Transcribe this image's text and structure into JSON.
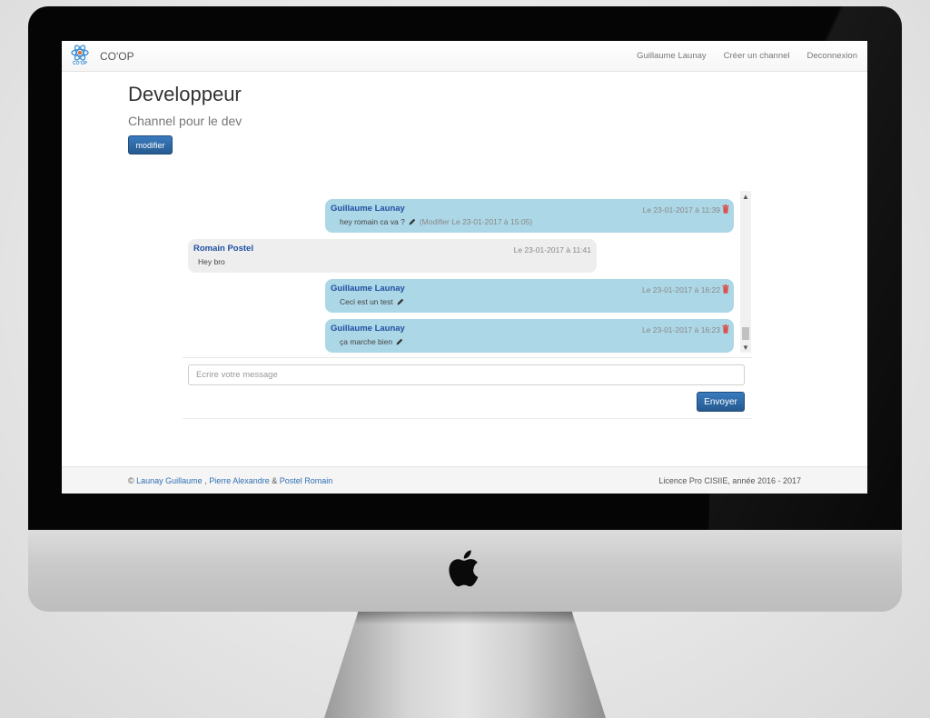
{
  "navbar": {
    "brand": "CO'OP",
    "logo_text": "CO'OP",
    "links": [
      "Guillaume Launay",
      "Créer un channel",
      "Deconnexion"
    ]
  },
  "channel": {
    "title": "Developpeur",
    "description": "Channel pour le dev",
    "modify_label": "modifier"
  },
  "messages": [
    {
      "author": "Guillaume Launay",
      "date": "Le 23-01-2017 à 11:39",
      "text": "hey romain ca va ?",
      "edit_note": "(Modifier Le 23-01-2017 à 15:05)",
      "mine": true
    },
    {
      "author": "Romain Postel",
      "date": "Le 23-01-2017 à 11:41",
      "text": "Hey bro",
      "mine": false
    },
    {
      "author": "Guillaume Launay",
      "date": "Le 23-01-2017 à 16:22",
      "text": "Ceci est un test",
      "mine": true
    },
    {
      "author": "Guillaume Launay",
      "date": "Le 23-01-2017 à 16:23",
      "text": "ça marche bien",
      "mine": true
    }
  ],
  "composer": {
    "placeholder": "Ecrire votre message",
    "send_label": "Envoyer"
  },
  "footer": {
    "copyright": "©",
    "author1": "Launay Guillaume",
    "sep1": " , ",
    "author2": "Pierre Alexandre",
    "sep2": " & ",
    "author3": "Postel Romain",
    "license": "Licence Pro CISIIE, année 2016 - 2017"
  },
  "colors": {
    "accent": "#2f6fb3",
    "my_message_bg": "#acd7e6",
    "other_message_bg": "#eeeeee",
    "author_color": "#1f4fa3",
    "delete_icon": "#d9534f"
  }
}
